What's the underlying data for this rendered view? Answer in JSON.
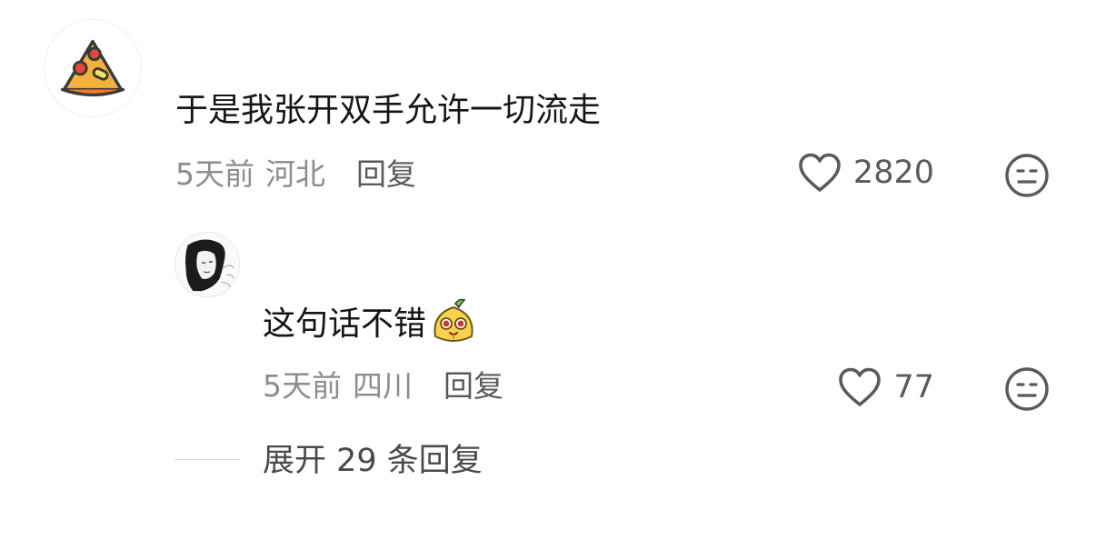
{
  "main_comment": {
    "avatar": "pizza-slice-avatar",
    "text": "于是我张开双手允许一切流走",
    "time": "5天前",
    "location": "河北",
    "reply_label": "回复",
    "likes": "2820"
  },
  "reply_comment": {
    "avatar": "sketch-portrait-avatar",
    "text": "这句话不错",
    "sticker": "yellow-bun-sticker",
    "time": "5天前",
    "location": "四川",
    "reply_label": "回复",
    "likes": "77"
  },
  "expand_replies_label": "展开 29 条回复",
  "icons": {
    "like": "heart-outline-icon",
    "dislike": "meh-face-icon"
  },
  "colors": {
    "text_primary": "#161616",
    "text_meta": "#8d8d8d",
    "text_action": "#5a5a5a"
  }
}
